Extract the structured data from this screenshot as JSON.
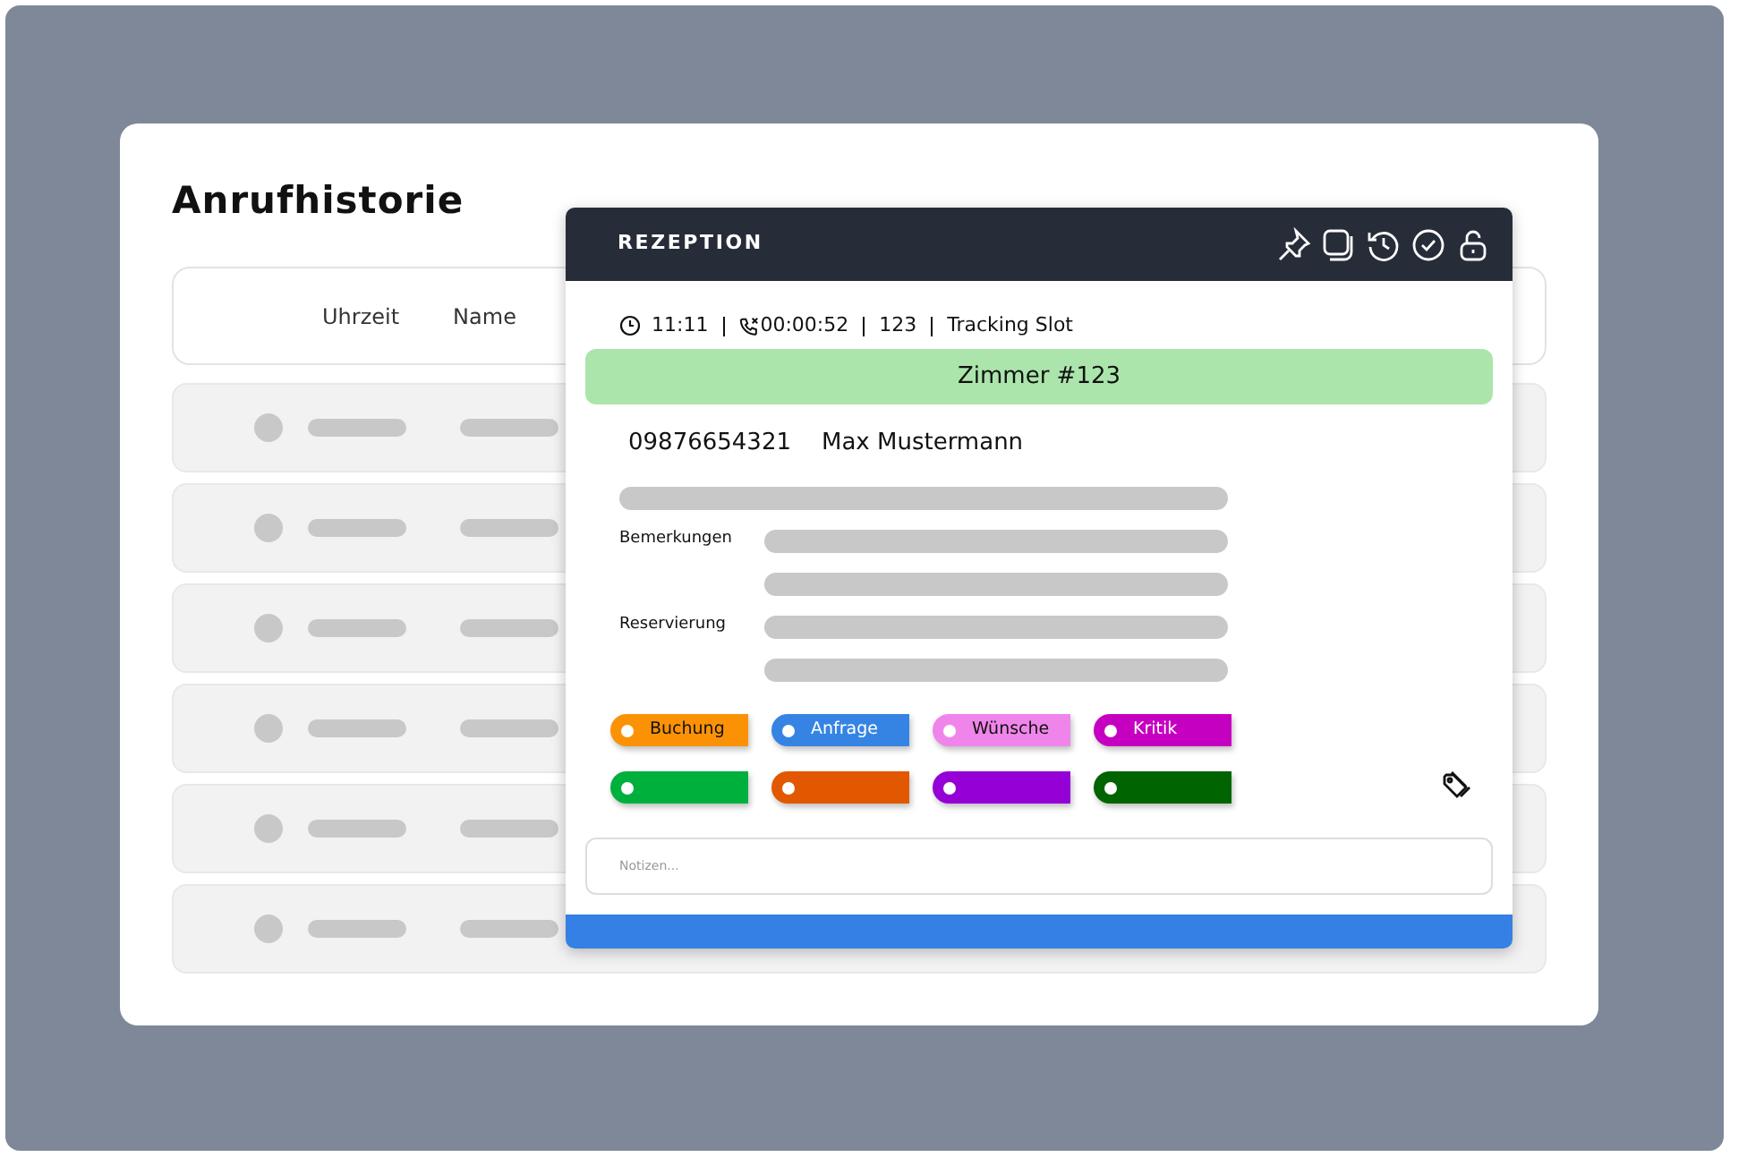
{
  "page": {
    "title": "Anrufhistorie"
  },
  "table": {
    "columns": [
      "Uhrzeit",
      "Name"
    ],
    "rows": [
      {
        "kind": "placeholder"
      },
      {
        "kind": "placeholder"
      },
      {
        "kind": "placeholder"
      },
      {
        "kind": "placeholder"
      },
      {
        "kind": "placeholder"
      },
      {
        "kind": "placeholder"
      }
    ]
  },
  "popup": {
    "title": "REZEPTION",
    "info": [
      {
        "kind": "time",
        "text": "11:11"
      },
      {
        "kind": "duration",
        "text": "00:00:52"
      },
      {
        "kind": "plain",
        "text": "123"
      },
      {
        "kind": "plain",
        "text": "Tracking Slot"
      }
    ],
    "room": "Zimmer #123",
    "phone": "09876654321",
    "caller": "Max Mustermann",
    "fields": [
      {
        "kind": "bar"
      },
      {
        "kind": "labeled",
        "label": "Bemerkungen"
      },
      {
        "kind": "indent"
      },
      {
        "kind": "labeled",
        "label": "Reservierung"
      },
      {
        "kind": "indent"
      }
    ],
    "tags": [
      {
        "label": "Buchung",
        "color": "#fb9206"
      },
      {
        "label": "Anfrage",
        "color": "#3584e4"
      },
      {
        "label": "Wünsche",
        "color": "#ef85ea"
      },
      {
        "label": "Kritik",
        "color": "#c600c0"
      },
      {
        "color": "#00b03c"
      },
      {
        "color": "#e25800"
      },
      {
        "color": "#9500d6"
      },
      {
        "color": "#006400"
      }
    ],
    "notes": {
      "placeholder": "Notizen..."
    }
  }
}
